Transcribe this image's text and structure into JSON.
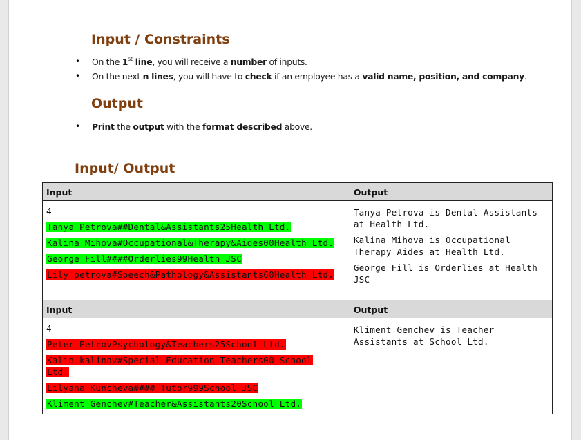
{
  "sections": {
    "constraints_title": "Input / Constraints",
    "output_title": "Output",
    "io_title": "Input/ Output"
  },
  "constraints": [
    {
      "pre": "On the ",
      "b1": "1",
      "sup": "st",
      "b1b": " line",
      "mid": ", you will receive a ",
      "b2": "number",
      "post": " of inputs."
    },
    {
      "pre": "On the next ",
      "b1": "n lines",
      "mid": ", you will have to ",
      "b2": "check",
      "mid2": " if an employee has a ",
      "b3": "valid name, position, and company",
      "post": "."
    }
  ],
  "output_rules": [
    {
      "b1": "Print",
      "mid": " the ",
      "b2": "output",
      "mid2": " with the ",
      "b3": "format described",
      "b4": " above."
    }
  ],
  "examples": [
    {
      "input_header": "Input",
      "output_header": "Output",
      "count": "4",
      "lines": [
        {
          "text": "Tanya Petrova##Dental&Assistants25Health Ltd.",
          "valid": true
        },
        {
          "text": "Kalina Mihova#Occupational&Therapy&Aides00Health Ltd.",
          "valid": true
        },
        {
          "text": "George Fill####Orderlies99Health JSC",
          "valid": true
        },
        {
          "text": "Lily petrova#Speech&Pathology&Assistants60Health Ltd.",
          "valid": false
        }
      ],
      "outputs": [
        "Tanya Petrova is Dental Assistants at Health Ltd.",
        "Kalina Mihova is Occupational Therapy Aides at Health Ltd.",
        "George Fill is Orderlies at Health JSC"
      ]
    },
    {
      "input_header": "Input",
      "output_header": "Output",
      "count": "4",
      "lines": [
        {
          "text": "Peter PetrovPsychology&Teachers25School Ltd.",
          "valid": false
        },
        {
          "text": "Kalin kalinov#Special Education Teachers00 School Ltd.",
          "valid": false
        },
        {
          "text": "Lilyana Kuncheva#### Tutor999School JSC",
          "valid": false
        },
        {
          "text": "Kliment Genchev#Teacher&Assistants20School Ltd.",
          "valid": true
        }
      ],
      "outputs": [
        "Kliment Genchev is Teacher Assistants at School Ltd."
      ]
    }
  ],
  "colors": {
    "heading": "#7f3f0f",
    "valid_highlight": "#00ff00",
    "invalid_highlight": "#ff0000",
    "header_fill": "#d9d9d9"
  }
}
